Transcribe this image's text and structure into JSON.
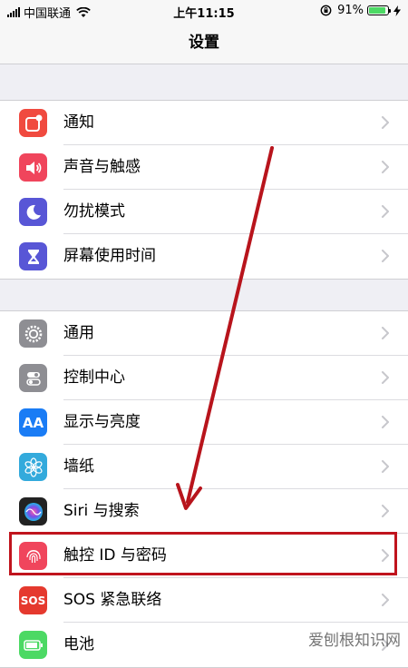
{
  "status_bar": {
    "carrier": "中国联通",
    "time": "上午11:15",
    "battery_percent": "91%",
    "battery_level": 0.91
  },
  "nav": {
    "title": "设置"
  },
  "groups": [
    {
      "items": [
        {
          "label": "通知",
          "icon": "notifications-icon",
          "color": "#f04a3f"
        },
        {
          "label": "声音与触感",
          "icon": "sound-icon",
          "color": "#f0455c"
        },
        {
          "label": "勿扰模式",
          "icon": "moon-icon",
          "color": "#5856d6"
        },
        {
          "label": "屏幕使用时间",
          "icon": "hourglass-icon",
          "color": "#5856d6"
        }
      ]
    },
    {
      "items": [
        {
          "label": "通用",
          "icon": "gear-icon",
          "color": "#8e8e93"
        },
        {
          "label": "控制中心",
          "icon": "switches-icon",
          "color": "#8e8e93"
        },
        {
          "label": "显示与亮度",
          "icon": "display-icon",
          "color": "#1a7cf5",
          "glyph": "AA"
        },
        {
          "label": "墙纸",
          "icon": "flower-icon",
          "color": "#33aadc"
        },
        {
          "label": "Siri 与搜索",
          "icon": "siri-icon",
          "color": "#222222"
        },
        {
          "label": "触控 ID 与密码",
          "icon": "fingerprint-icon",
          "color": "#f0455c"
        },
        {
          "label": "SOS 紧急联络",
          "icon": "sos-icon",
          "color": "#e5392e",
          "glyph": "SOS"
        },
        {
          "label": "电池",
          "icon": "battery-icon",
          "color": "#4cd964"
        }
      ]
    }
  ],
  "annotation": {
    "highlight_color": "#c0141d"
  },
  "watermark": "爱刨根知识网"
}
